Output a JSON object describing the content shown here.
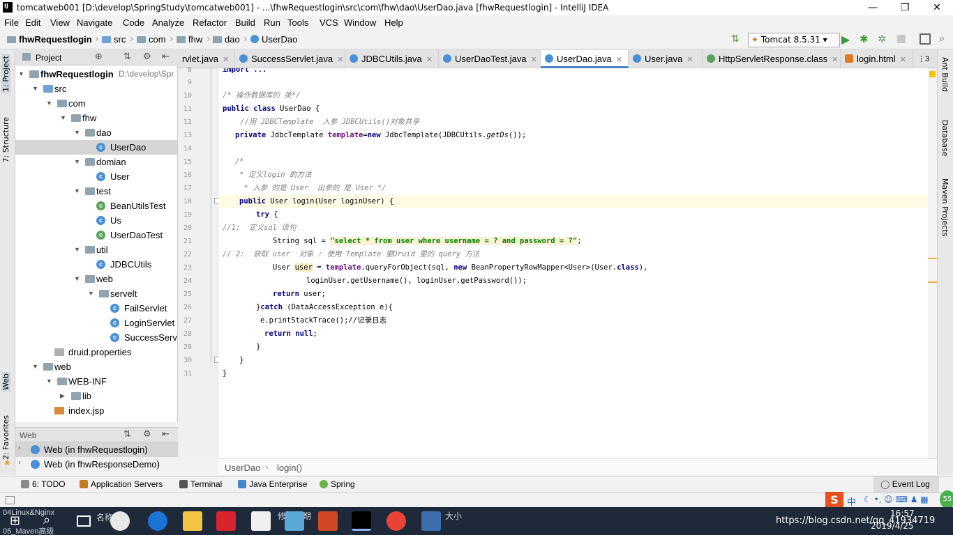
{
  "window": {
    "title": "tomcatweb001 [D:\\develop\\SpringStudy\\tomcatweb001] - ...\\fhwRequestlogin\\src\\com\\fhw\\dao\\UserDao.java [fhwRequestlogin] - IntelliJ IDEA",
    "minimize": "—",
    "maximize": "❒",
    "close": "✕"
  },
  "menu": [
    "File",
    "Edit",
    "View",
    "Navigate",
    "Code",
    "Analyze",
    "Refactor",
    "Build",
    "Run",
    "Tools",
    "VCS",
    "Window",
    "Help"
  ],
  "breadcrumbs": [
    "fhwRequestlogin",
    "src",
    "com",
    "fhw",
    "dao",
    "UserDao"
  ],
  "run_config": "Tomcat 8.5.31",
  "left_tool_windows": [
    "1: Project",
    "7: Structure",
    "Web",
    "2: Favorites"
  ],
  "right_tool_windows": [
    "Ant Build",
    "Database",
    "Maven Projects"
  ],
  "project_panel": {
    "title": "Project",
    "tree": [
      {
        "label": "fhwRequestlogin",
        "extra": "D:\\develop\\Spr",
        "level": 0,
        "kind": "module",
        "expanded": true
      },
      {
        "label": "src",
        "level": 1,
        "kind": "src",
        "expanded": true
      },
      {
        "label": "com",
        "level": 2,
        "kind": "folder",
        "expanded": true
      },
      {
        "label": "fhw",
        "level": 3,
        "kind": "folder",
        "expanded": true
      },
      {
        "label": "dao",
        "level": 4,
        "kind": "folder",
        "expanded": true
      },
      {
        "label": "UserDao",
        "level": 5,
        "kind": "class",
        "selected": true
      },
      {
        "label": "domian",
        "level": 4,
        "kind": "folder",
        "expanded": true
      },
      {
        "label": "User",
        "level": 5,
        "kind": "class"
      },
      {
        "label": "test",
        "level": 4,
        "kind": "folder",
        "expanded": true
      },
      {
        "label": "BeanUtilsTest",
        "level": 5,
        "kind": "testclass"
      },
      {
        "label": "Us",
        "level": 5,
        "kind": "class"
      },
      {
        "label": "UserDaoTest",
        "level": 5,
        "kind": "testclass"
      },
      {
        "label": "util",
        "level": 4,
        "kind": "folder",
        "expanded": true
      },
      {
        "label": "JDBCUtils",
        "level": 5,
        "kind": "class"
      },
      {
        "label": "web",
        "level": 4,
        "kind": "folder",
        "expanded": true
      },
      {
        "label": "servelt",
        "level": 5,
        "kind": "folder",
        "expanded": true
      },
      {
        "label": "FailServlet",
        "level": 6,
        "kind": "class"
      },
      {
        "label": "LoginServlet",
        "level": 6,
        "kind": "class"
      },
      {
        "label": "SuccessServle",
        "level": 6,
        "kind": "class"
      },
      {
        "label": "druid.properties",
        "level": 2,
        "kind": "file"
      },
      {
        "label": "web",
        "level": 1,
        "kind": "folder",
        "expanded": true
      },
      {
        "label": "WEB-INF",
        "level": 2,
        "kind": "folder",
        "expanded": true
      },
      {
        "label": "lib",
        "level": 3,
        "kind": "folder",
        "expanded": false
      },
      {
        "label": "index.jsp",
        "level": 2,
        "kind": "jsp"
      }
    ]
  },
  "web_panel": {
    "title": "Web",
    "items": [
      "Web (in fhwRequestlogin)",
      "Web (in fhwResponseDemo)"
    ]
  },
  "editor_tabs": [
    {
      "label": "rvlet.java",
      "icon": "class-icon"
    },
    {
      "label": "SuccessServlet.java",
      "icon": "class-icon"
    },
    {
      "label": "JDBCUtils.java",
      "icon": "class-icon"
    },
    {
      "label": "UserDaoTest.java",
      "icon": "class-icon"
    },
    {
      "label": "UserDao.java",
      "icon": "class-icon",
      "active": true
    },
    {
      "label": "User.java",
      "icon": "class-icon"
    },
    {
      "label": "HttpServletResponse.class",
      "icon": "interface-icon"
    },
    {
      "label": "login.html",
      "icon": "html-icon"
    }
  ],
  "tab_overflow": "⋮3",
  "code": {
    "line_numbers": [
      "8",
      "9",
      "10",
      "11",
      "12",
      "13",
      "14",
      "15",
      "16",
      "17",
      "18",
      "19",
      "20",
      "21",
      "22",
      "23",
      "24",
      "25",
      "26",
      "27",
      "28",
      "29",
      "30",
      "31"
    ],
    "l8": "import ...",
    "l9": "/* 操作数据库的 类*/",
    "l10a": "public class",
    "l10b": " UserDao {",
    "l11": "    //用 JDBCTemplate  入参 JDBCUtils()对象共享",
    "l12a": "private",
    "l12b": " JdbcTemplate ",
    "l12c": "template",
    "l12d": "=",
    "l12e": "new",
    "l12f": " JdbcTemplate(JDBCUtils.",
    "l12g": "getDs",
    "l12h": "());",
    "l14": "/*",
    "l15": " * 定义login 的方法",
    "l16": "  * 入参 的是 User  出参的 是 User */",
    "l17a": "public",
    "l17b": " User login(User loginUser) {",
    "l18": "try",
    "l18b": " {",
    "l19": "//1:  定义sql 语句",
    "l20a": "String sql = ",
    "l20b": "\"select * from user where username = ? and password = ?\"",
    "l20c": ";",
    "l21": "// 2:  获取 user  对象 : 使用 Template 里Druid 里的 query 方法",
    "l22a": "User ",
    "l22b": "user",
    "l22c": " = ",
    "l22d": "template",
    "l22e": ".queryForObject(sql, ",
    "l22f": "new",
    "l22g": " BeanPropertyRowMapper<User>(User.",
    "l22h": "class",
    "l22i": "),",
    "l23": "loginUser.getUsername(), loginUser.getPassword());",
    "l24a": "return",
    "l24b": " user;",
    "l25a": "}",
    "l25b": "catch",
    "l25c": " (DataAccessException e){",
    "l26": "e.printStackTrace();//记录日志",
    "l27a": "return",
    "l27b": " null",
    "l27c": ";",
    "l28": "}",
    "l29": "}",
    "l30": "}"
  },
  "editor_breadcrumb": [
    "UserDao",
    "login()"
  ],
  "bottom_tools": [
    "6: TODO",
    "Application Servers",
    "Terminal",
    "Java Enterprise",
    "Spring"
  ],
  "event_log": "Event Log",
  "taskbar": {
    "left_text_top": "04Linux&Nginx",
    "left_text_bottom": "05_Maven高级",
    "mid_text_1": "名称",
    "mid_text_2": "修改日期",
    "mid_text_3": "大小",
    "time": "16:57",
    "date": "2019/4/25",
    "watermark": "https://blog.csdn.net/qq_41934719",
    "ime": "中",
    "badge": "55"
  }
}
